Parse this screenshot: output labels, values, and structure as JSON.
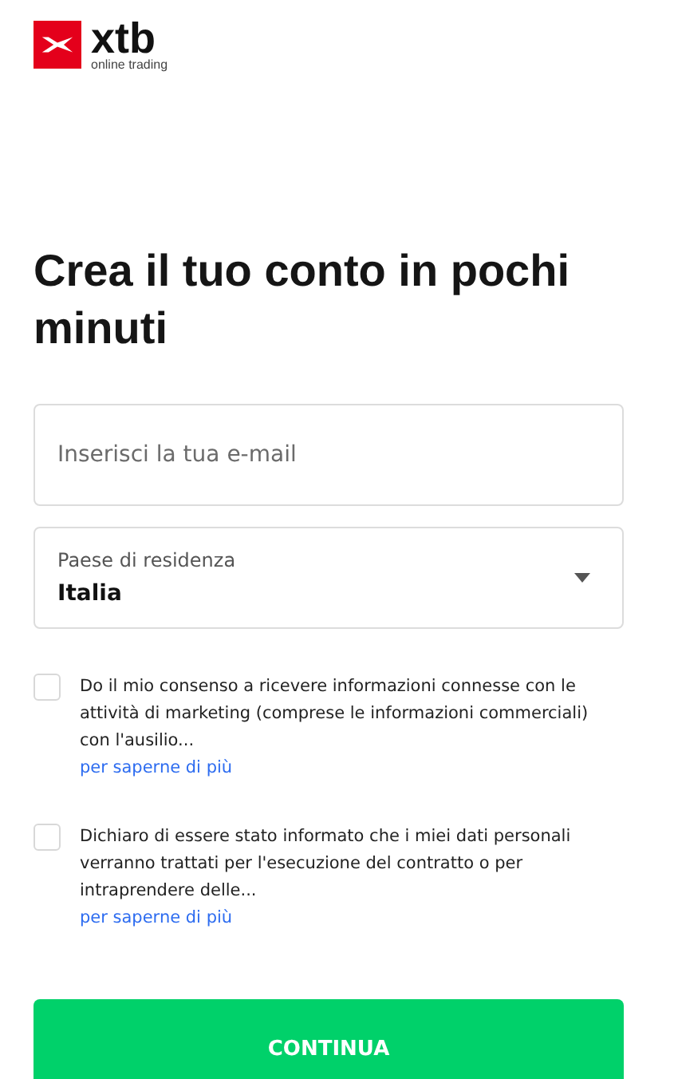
{
  "logo": {
    "wordmark": "xtb",
    "tagline": "online trading"
  },
  "heading": "Crea il tuo conto in pochi minuti",
  "email": {
    "placeholder": "Inserisci la tua e-mail"
  },
  "country": {
    "label": "Paese di residenza",
    "value": "Italia"
  },
  "consents": [
    {
      "text": "Do il mio consenso a ricevere informazioni connesse con le attività di marketing (comprese le informazioni commerciali) con l'ausilio...",
      "link": "per saperne di più",
      "checked": false
    },
    {
      "text": "Dichiaro di essere stato informato che i miei dati personali verranno trattati per l'esecuzione del contratto o per intraprendere delle...",
      "link": "per saperne di più",
      "checked": false
    }
  ],
  "submit": "CONTINUA"
}
